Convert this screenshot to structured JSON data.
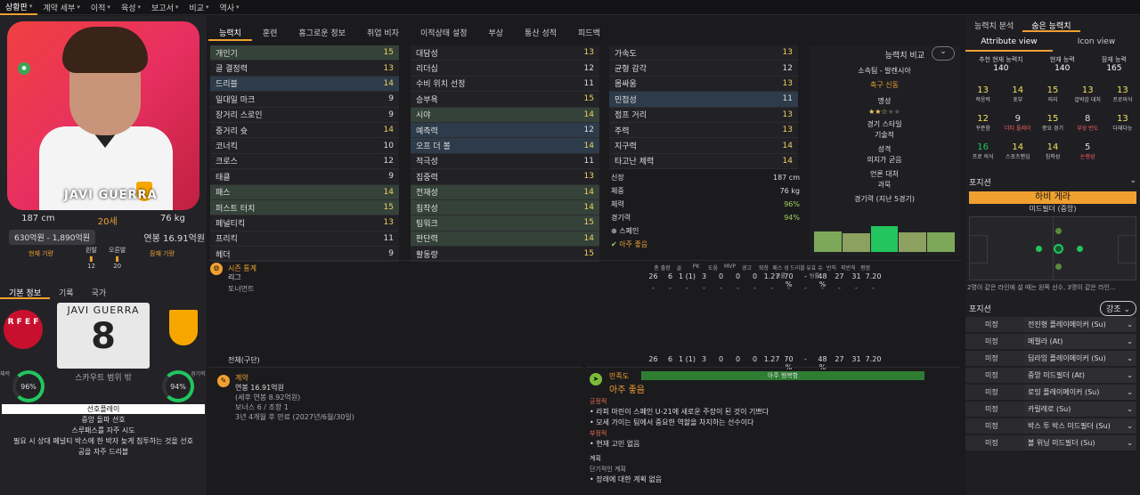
{
  "nav": {
    "items": [
      {
        "label": "상황판",
        "active": true
      },
      {
        "label": "계약 세부"
      },
      {
        "label": "이적"
      },
      {
        "label": "육성"
      },
      {
        "label": "보고서"
      },
      {
        "label": "비교"
      },
      {
        "label": "역사"
      }
    ]
  },
  "player": {
    "name_overlay": "JAVI GUERRA",
    "height": "187 cm",
    "age": "20세",
    "weight": "76 kg",
    "value": "630억원 - 1,890억원",
    "wage": "연봉 16.91억원",
    "current_fitness_label": "현재 기량",
    "potential_label": "잠재 기량",
    "left_foot_label": "왼발",
    "right_foot_label": "오른발",
    "left_foot": "12",
    "right_foot": "20",
    "shirt_name": "JAVI GUERRA",
    "shirt_number": "8",
    "scout_text": "스카우트 범위 밖",
    "fitness_label": "체력",
    "fitness_pct": "96%",
    "match_fitness_label": "경기력",
    "match_fitness_pct": "94%",
    "rfef_text": "R F E F"
  },
  "info_tabs": [
    "기본 정보",
    "기록",
    "국가"
  ],
  "playstyle": {
    "header": "선호플레이",
    "lines": [
      "중앙 돌파 선호",
      "스루패스를 자주 시도",
      "필요 시 상대 페널티 박스에 한 박자 늦게 침투하는 것을 선호",
      "공을 자주 드리블"
    ]
  },
  "tabs": [
    "능력치",
    "훈련",
    "흥그로운 정보",
    "취업 비자",
    "이적상태 설정",
    "부상",
    "통산 성적",
    "피드백"
  ],
  "attr_col1": [
    {
      "n": "개인기",
      "v": "15",
      "hl": "hl"
    },
    {
      "n": "골 결정력",
      "v": "13"
    },
    {
      "n": "드리블",
      "v": "14",
      "hl": "hl2"
    },
    {
      "n": "일대일 마크",
      "v": "9"
    },
    {
      "n": "장거리 스로인",
      "v": "9"
    },
    {
      "n": "중거리 슛",
      "v": "14"
    },
    {
      "n": "코너킥",
      "v": "10"
    },
    {
      "n": "크로스",
      "v": "12"
    },
    {
      "n": "태클",
      "v": "9"
    },
    {
      "n": "패스",
      "v": "14",
      "hl": "hl"
    },
    {
      "n": "퍼스트 터치",
      "v": "15",
      "hl": "hl"
    },
    {
      "n": "페널티킥",
      "v": "13"
    },
    {
      "n": "프리킥",
      "v": "11"
    },
    {
      "n": "헤더",
      "v": "9"
    }
  ],
  "attr_col2": [
    {
      "n": "대담성",
      "v": "13"
    },
    {
      "n": "리더십",
      "v": "12"
    },
    {
      "n": "수비 위치 선정",
      "v": "11"
    },
    {
      "n": "승부욕",
      "v": "15"
    },
    {
      "n": "시야",
      "v": "14",
      "hl": "hl"
    },
    {
      "n": "예측력",
      "v": "12",
      "hl": "hl2"
    },
    {
      "n": "오프 더 볼",
      "v": "14",
      "hl": "hl2"
    },
    {
      "n": "적극성",
      "v": "11"
    },
    {
      "n": "집중력",
      "v": "13"
    },
    {
      "n": "전재성",
      "v": "14",
      "hl": "hl"
    },
    {
      "n": "침착성",
      "v": "14",
      "hl": "hl"
    },
    {
      "n": "팀워크",
      "v": "15",
      "hl": "hl"
    },
    {
      "n": "판단력",
      "v": "14",
      "hl": "hl"
    },
    {
      "n": "활동량",
      "v": "15"
    }
  ],
  "attr_col3": [
    {
      "n": "가속도",
      "v": "13"
    },
    {
      "n": "균형 감각",
      "v": "12"
    },
    {
      "n": "몸싸움",
      "v": "13"
    },
    {
      "n": "민첩성",
      "v": "11",
      "hl": "hl2"
    },
    {
      "n": "점프 거리",
      "v": "13"
    },
    {
      "n": "주력",
      "v": "13"
    },
    {
      "n": "지구력",
      "v": "14"
    },
    {
      "n": "타고난 체력",
      "v": "14"
    }
  ],
  "mini": {
    "height_label": "신장",
    "height": "187 cm",
    "weight_label": "체중",
    "weight": "76 kg",
    "fit_label": "체력",
    "fit": "96%",
    "mfit_label": "경기력",
    "mfit": "94%",
    "nation": "스페인",
    "status": "아주 좋음"
  },
  "compare": {
    "title": "능력치 비교",
    "club": "소속팀 - 발렌시아",
    "club_value": "축구 신동",
    "rep_label": "명성",
    "style_label": "경기 스타일",
    "style": "기술적",
    "pers_label": "성격",
    "pers": "의지가 굳음",
    "media_label": "언론 대처",
    "media": "과묵",
    "form_label": "경기력 (지난 5경기)"
  },
  "season": {
    "title": "시즌 통계",
    "cols": [
      "총 출장",
      "골",
      "PK",
      "도움",
      "MVP",
      "경고",
      "퇴장",
      "패스 성공률",
      "드리블",
      "유효 슈팅률",
      "반칙",
      "피반칙",
      "평점"
    ],
    "league_label": "리그",
    "league": [
      "26",
      "6",
      "1 (1)",
      "3",
      "0",
      "0",
      "0",
      "1.27",
      "70 %",
      "-",
      "48 %",
      "27",
      "31",
      "7.20"
    ],
    "cup_label": "토너먼트",
    "cup": [
      "-",
      "-",
      "-",
      "-",
      "-",
      "-",
      "-",
      "-",
      "-",
      "-",
      "-",
      "-",
      "-",
      "-"
    ],
    "total_label": "전체(구단)",
    "total": [
      "26",
      "6",
      "1 (1)",
      "3",
      "0",
      "0",
      "0",
      "1.27",
      "70 %",
      "-",
      "48 %",
      "27",
      "31",
      "7.20"
    ]
  },
  "contract": {
    "title": "계약",
    "wage": "연봉 16.91억원",
    "sub": "(세후 연봉 8.92억원)",
    "bonus": "보너스 6 / 조항 1",
    "end": "3년 4개월 후 만료 (2027년/6월/30일)"
  },
  "satisfaction": {
    "title": "만족도",
    "bar": "아주 행복함",
    "status": "아주 좋음",
    "pos_label": "긍정적",
    "pos": [
      "라피 마린이 스페인 U-21에 새로운 주장이 된 것이 기쁘다",
      "모세 가이는 팀에서 중요한 역할을 차지하는 선수이다"
    ],
    "neg_label": "부정적",
    "neg": [
      "현재 고민 없음"
    ],
    "plan_label": "계획",
    "short_label": "단기적인 계획",
    "plan": [
      "장래에 대한 계획 없음"
    ]
  },
  "right": {
    "tabs": [
      "능력치 분석",
      "숨은 능력치"
    ],
    "views": [
      "Attribute view",
      "Icon view"
    ],
    "cur": [
      {
        "l": "추천 현재 능력치",
        "n": "140"
      },
      {
        "l": "현재 능력",
        "n": "140"
      },
      {
        "l": "잠재 능력",
        "n": "165"
      }
    ],
    "grid": [
      {
        "n": "13",
        "l": "적응력"
      },
      {
        "n": "14",
        "l": "포부"
      },
      {
        "n": "15",
        "l": "의리"
      },
      {
        "n": "13",
        "l": "압박감 대처"
      },
      {
        "n": "13",
        "l": "프로의식"
      },
      {
        "n": "12",
        "l": "꾸준함"
      },
      {
        "n": "9",
        "l": "더티 플레이",
        "lc": "r",
        "nc": "w"
      },
      {
        "n": "15",
        "l": "중요 경기"
      },
      {
        "n": "8",
        "l": "부상 빈도",
        "lc": "r",
        "nc": "w"
      },
      {
        "n": "13",
        "l": "다재다능"
      },
      {
        "n": "16",
        "l": "프로 의식",
        "nc": "g"
      },
      {
        "n": "14",
        "l": "스포츠맨십"
      },
      {
        "n": "14",
        "l": "침착성"
      },
      {
        "n": "5",
        "l": "논쟁성",
        "lc": "r",
        "nc": "w"
      }
    ],
    "pos_title": "포지션",
    "pos_banner": "하비 게라",
    "pos_sub": "미드필더 (중앙)",
    "pos_note": "2명이 같은 라인에 설 때는 왼쪽 선수, 3명이 같은 라인...",
    "roles_label": "포지션",
    "strong": "강조",
    "roles": [
      {
        "st": "미정",
        "rn": "전진형 플레이메이커 (Su)"
      },
      {
        "st": "미정",
        "rn": "메찔라 (At)"
      },
      {
        "st": "미정",
        "rn": "딥라잉 플레이메이커 (Su)"
      },
      {
        "st": "미정",
        "rn": "중앙 미드필더 (At)"
      },
      {
        "st": "미정",
        "rn": "로밍 플레이메이커 (Su)"
      },
      {
        "st": "미정",
        "rn": "카릴레로 (Su)"
      },
      {
        "st": "미정",
        "rn": "박스 투 박스 미드필더 (Su)"
      },
      {
        "st": "미정",
        "rn": "볼 위닝 미드필더 (Su)"
      }
    ]
  }
}
